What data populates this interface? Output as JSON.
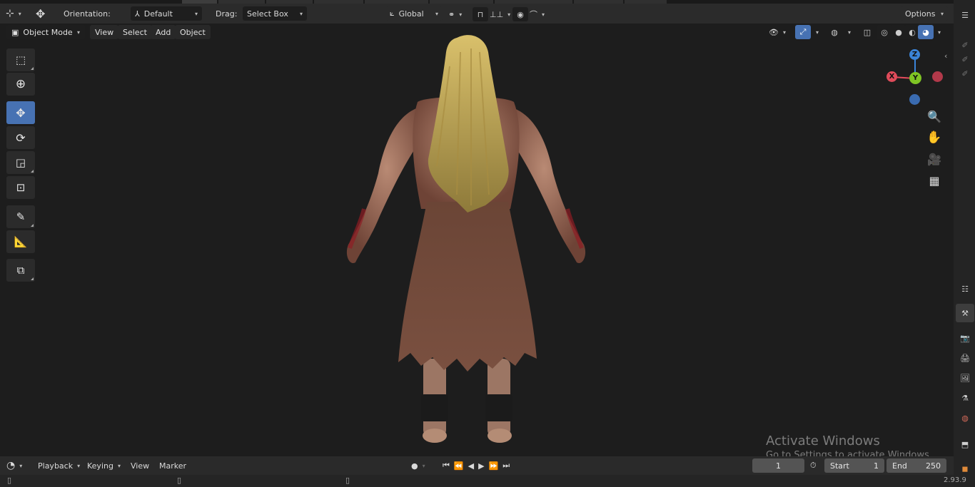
{
  "topbar": {
    "orientation_label": "Orientation:",
    "orientation_value": "Default",
    "drag_label": "Drag:",
    "drag_value": "Select Box",
    "transform_orientation": "Global",
    "options_label": "Options"
  },
  "header": {
    "mode": "Object Mode",
    "menus": [
      "View",
      "Select",
      "Add",
      "Object"
    ]
  },
  "timeline": {
    "menus": [
      "Playback",
      "Keying",
      "View",
      "Marker"
    ],
    "current_frame": "1",
    "start_label": "Start",
    "start_value": "1",
    "end_label": "End",
    "end_value": "250"
  },
  "status": {
    "version": "2.93.9"
  },
  "gizmo": {
    "x": "X",
    "y": "Y",
    "z": "Z"
  },
  "watermark": {
    "title": "Activate Windows",
    "subtitle": "Go to Settings to activate Windows."
  },
  "colors": {
    "accent": "#4772b3",
    "axis_x": "#e04b5a",
    "axis_y": "#7fc424",
    "axis_z": "#3b84d8"
  }
}
